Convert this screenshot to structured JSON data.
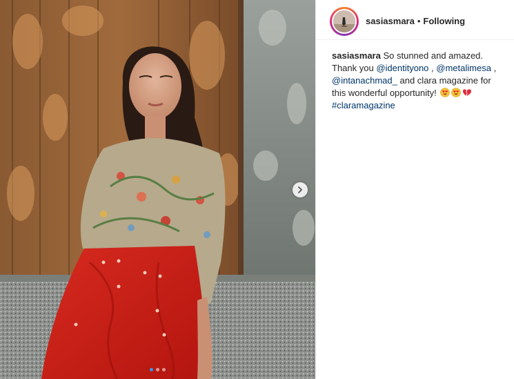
{
  "post": {
    "author": "sasiasmara",
    "separator": "•",
    "follow_status": "Following",
    "caption": {
      "username": "sasiasmara",
      "text_1": "So stunned and amazed. Thank you",
      "mention_1": "@identityono",
      "text_2": ",",
      "mention_2": "@metalimesa",
      "text_3": ",",
      "mention_3": "@intanachmad_",
      "text_4": "and clara magazine for this wonderful opportunity!",
      "emojis": [
        "heart-eyes-emoji",
        "heart-eyes-emoji",
        "broken-heart-emoji"
      ],
      "hashtag": "#claramagazine"
    },
    "carousel": {
      "total_slides": 3,
      "current_slide": 1
    },
    "colors": {
      "link": "#003569",
      "text": "#262626",
      "accent": "#3897f0",
      "border": "#efefef"
    }
  }
}
